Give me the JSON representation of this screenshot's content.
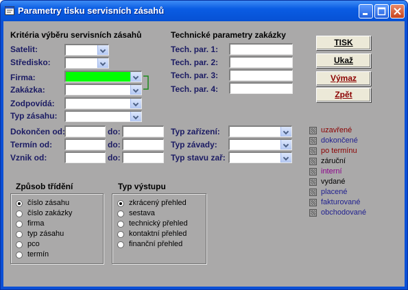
{
  "window": {
    "title": "Parametry tisku servisních zásahů"
  },
  "criteria": {
    "heading": "Kritéria výběru servisních zásahů",
    "fields": [
      {
        "label": "Satelit:",
        "value": ""
      },
      {
        "label": "Středisko:",
        "value": ""
      },
      {
        "label": "Firma:",
        "value": ""
      },
      {
        "label": "Zakázka:",
        "value": ""
      },
      {
        "label": "Zodpovídá:",
        "value": ""
      },
      {
        "label": "Typ zásahu:",
        "value": ""
      }
    ]
  },
  "tech": {
    "heading": "Technické parametry zakázky",
    "fields": [
      {
        "label": "Tech. par. 1:",
        "value": ""
      },
      {
        "label": "Tech. par. 2:",
        "value": ""
      },
      {
        "label": "Tech. par. 3:",
        "value": ""
      },
      {
        "label": "Tech. par. 4:",
        "value": ""
      }
    ]
  },
  "dates": [
    {
      "label": "Dokončen od:",
      "to_label": "do:"
    },
    {
      "label": "Termín od:",
      "to_label": "do:"
    },
    {
      "label": "Vznik od:",
      "to_label": "do:"
    }
  ],
  "types": [
    {
      "label": "Typ zařízení:"
    },
    {
      "label": "Typ závady:"
    },
    {
      "label": "Typ stavu zař:"
    }
  ],
  "buttons": {
    "print": "TISK",
    "show": "Ukaž",
    "clear": "Výmaz",
    "back": "Zpět"
  },
  "sort": {
    "title": "Způsob třídění",
    "options": [
      "číslo zásahu",
      "číslo zakázky",
      "firma",
      "typ zásahu",
      "pco",
      "termín"
    ],
    "selected": 0
  },
  "output": {
    "title": "Typ výstupu",
    "options": [
      "zkrácený přehled",
      "sestava",
      "technický přehled",
      "kontaktní přehled",
      "finanční přehled"
    ],
    "selected": 0
  },
  "statuses": [
    {
      "label": "uzavřené",
      "color": "#8b0000"
    },
    {
      "label": "dokončené",
      "color": "#1f1f8f"
    },
    {
      "label": "po termínu",
      "color": "#8b0000"
    },
    {
      "label": "záruční",
      "color": "#000000"
    },
    {
      "label": "interní",
      "color": "#8b008b"
    },
    {
      "label": "vydané",
      "color": "#000000"
    },
    {
      "label": "placené",
      "color": "#1f1f8f"
    },
    {
      "label": "fakturované",
      "color": "#1f1f8f"
    },
    {
      "label": "obchodované",
      "color": "#1f1f8f"
    }
  ],
  "colors": {
    "highlight_field": "#00ff00",
    "client_bg": "#aaa9a9",
    "titlebar": "#0a5ce3"
  }
}
